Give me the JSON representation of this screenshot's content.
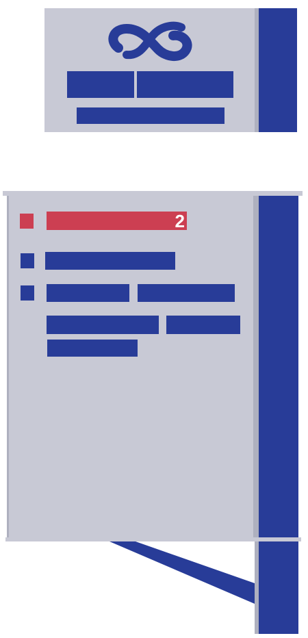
{
  "colors": {
    "navy": "#283c98",
    "panel_gray": "#c8c9d5",
    "edge_gray": "#aeb0bf",
    "highlight_red": "#cc3f52",
    "white": "#ffffff"
  },
  "directory": {
    "highlighted_row_number": "2"
  },
  "icons": {
    "logo": "infinity-symbol-icon"
  }
}
